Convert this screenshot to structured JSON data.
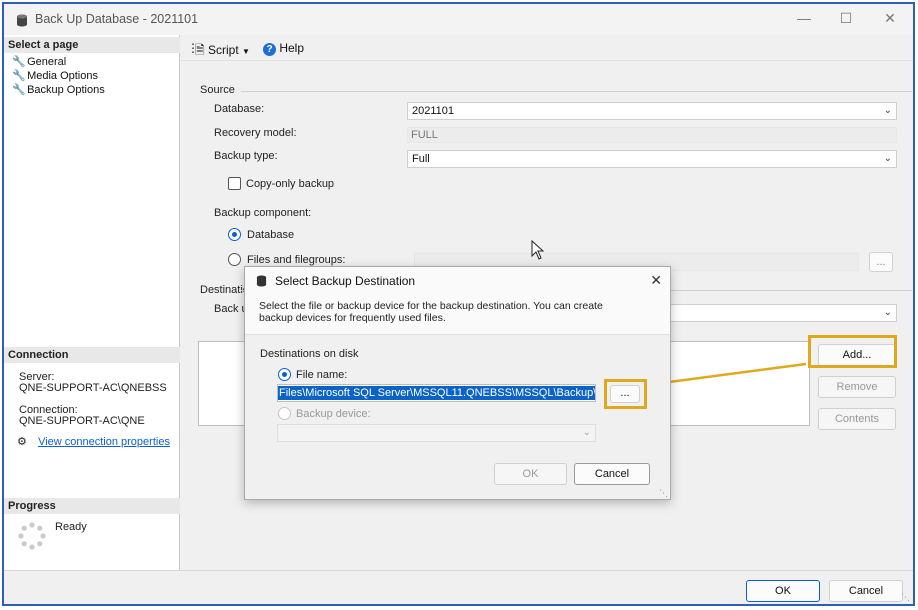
{
  "window": {
    "title": "Back Up Database - 2021101"
  },
  "left_pane": {
    "select_page_heading": "Select a page",
    "pages": [
      {
        "label": "General"
      },
      {
        "label": "Media Options"
      },
      {
        "label": "Backup Options"
      }
    ],
    "connection_heading": "Connection",
    "server_label": "Server:",
    "server_value": "QNE-SUPPORT-AC\\QNEBSS",
    "connection_label": "Connection:",
    "connection_value": "QNE-SUPPORT-AC\\QNE",
    "view_connection_link": "View connection properties",
    "progress_heading": "Progress",
    "progress_status": "Ready"
  },
  "toolbar": {
    "script_label": "Script",
    "help_label": "Help"
  },
  "source": {
    "heading": "Source",
    "database_label": "Database:",
    "database_value": "2021101",
    "recovery_label": "Recovery model:",
    "recovery_value": "FULL",
    "backup_type_label": "Backup type:",
    "backup_type_value": "Full",
    "copy_only_label": "Copy-only backup",
    "component_label": "Backup component:",
    "component_database": "Database",
    "component_files": "Files and filegroups:",
    "files_browse": "..."
  },
  "destination": {
    "heading": "Destinatio",
    "back_up_to": "Back u",
    "add_label": "Add...",
    "remove_label": "Remove",
    "contents_label": "Contents"
  },
  "dialog": {
    "title": "Select Backup Destination",
    "description_line1": "Select the file or backup device for the backup destination. You can create",
    "description_line2": "backup devices for frequently used files.",
    "destinations_heading": "Destinations on disk",
    "file_name_label": "File name:",
    "file_name_value": "Files\\Microsoft SQL Server\\MSSQL11.QNEBSS\\MSSQL\\Backup\\",
    "browse_label": "...",
    "backup_device_label": "Backup device:",
    "ok_label": "OK",
    "cancel_label": "Cancel"
  },
  "footer": {
    "ok_label": "OK",
    "cancel_label": "Cancel"
  },
  "colors": {
    "accent": "#0b5ed7",
    "highlight": "#e0a81c",
    "selection": "#0b63c7"
  }
}
